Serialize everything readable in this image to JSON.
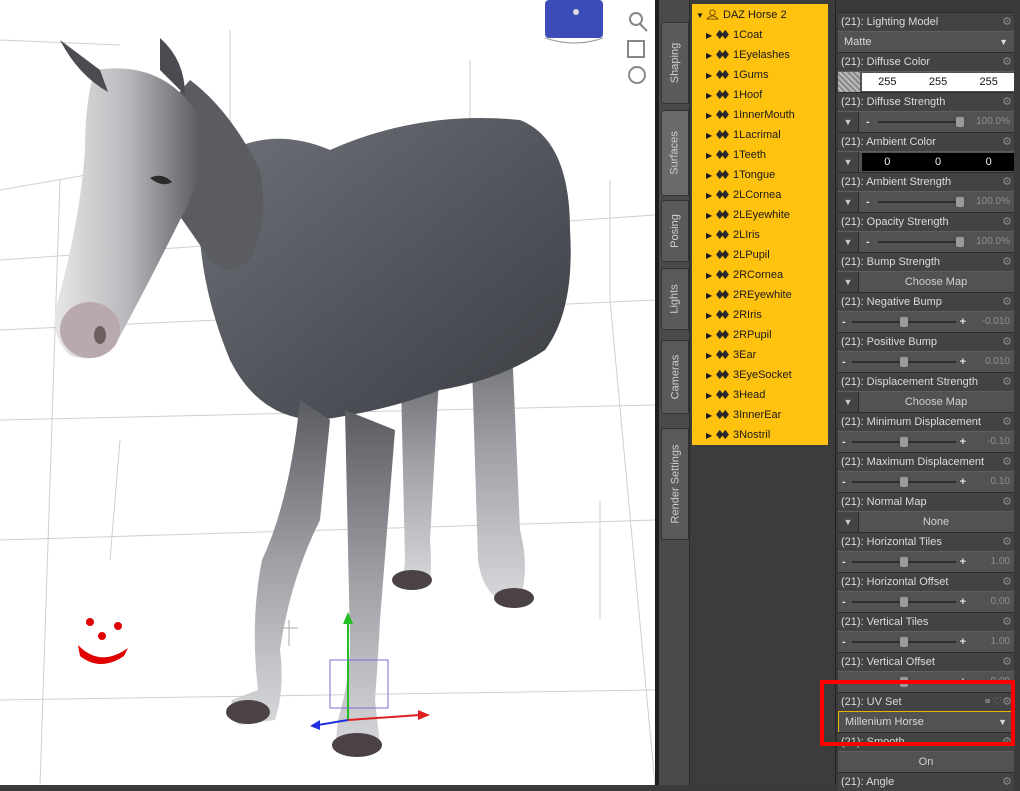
{
  "tabs": [
    "Shaping",
    "Surfaces",
    "Posing",
    "Lights",
    "Cameras",
    "Render Settings"
  ],
  "active_tab": "Surfaces",
  "scene": {
    "root": "DAZ Horse 2",
    "items": [
      "1Coat",
      "1Eyelashes",
      "1Gums",
      "1Hoof",
      "1InnerMouth",
      "1Lacrimal",
      "1Teeth",
      "1Tongue",
      "2LCornea",
      "2LEyewhite",
      "2LIris",
      "2LPupil",
      "2RCornea",
      "2REyewhite",
      "2RIris",
      "2RPupil",
      "3Ear",
      "3EyeSocket",
      "3Head",
      "3InnerEar",
      "3Nostril"
    ]
  },
  "props": {
    "lighting_model": {
      "title": "(21): Lighting Model",
      "value": "Matte"
    },
    "diffuse_color": {
      "title": "(21): Diffuse Color",
      "r": "255",
      "g": "255",
      "b": "255"
    },
    "diffuse_strength": {
      "title": "(21): Diffuse Strength",
      "value": "100.0%",
      "level": 1.0
    },
    "ambient_color": {
      "title": "(21): Ambient Color",
      "r": "0",
      "g": "0",
      "b": "0"
    },
    "ambient_strength": {
      "title": "(21): Ambient Strength",
      "value": "100.0%",
      "level": 1.0
    },
    "opacity_strength": {
      "title": "(21): Opacity Strength",
      "value": "100.0%",
      "level": 1.0
    },
    "bump_strength": {
      "title": "(21): Bump Strength",
      "value": "Choose Map"
    },
    "negative_bump": {
      "title": "(21): Negative Bump",
      "value": "-0.010",
      "level": 0.5
    },
    "positive_bump": {
      "title": "(21): Positive Bump",
      "value": "0.010",
      "level": 0.5
    },
    "displacement_strength": {
      "title": "(21): Displacement Strength",
      "value": "Choose Map"
    },
    "minimum_displacement": {
      "title": "(21): Minimum Displacement",
      "value": "-0.10",
      "level": 0.5
    },
    "maximum_displacement": {
      "title": "(21): Maximum Displacement",
      "value": "0.10",
      "level": 0.5
    },
    "normal_map": {
      "title": "(21): Normal Map",
      "value": "None"
    },
    "horizontal_tiles": {
      "title": "(21): Horizontal Tiles",
      "value": "1.00",
      "level": 0.5
    },
    "horizontal_offset": {
      "title": "(21): Horizontal Offset",
      "value": "0.00",
      "level": 0.5
    },
    "vertical_tiles": {
      "title": "(21): Vertical Tiles",
      "value": "1.00",
      "level": 0.5
    },
    "vertical_offset": {
      "title": "(21): Vertical Offset",
      "value": "0.00",
      "level": 0.5
    },
    "uv_set": {
      "title": "(21): UV Set",
      "value": "Millenium Horse"
    },
    "smooth": {
      "title": "(21): Smooth",
      "value": "On"
    },
    "angle": {
      "title": "(21): Angle"
    }
  },
  "colors": {
    "highlight": "#ff0000",
    "scene_bg": "#ffc20e",
    "accent": "#e8b400"
  }
}
